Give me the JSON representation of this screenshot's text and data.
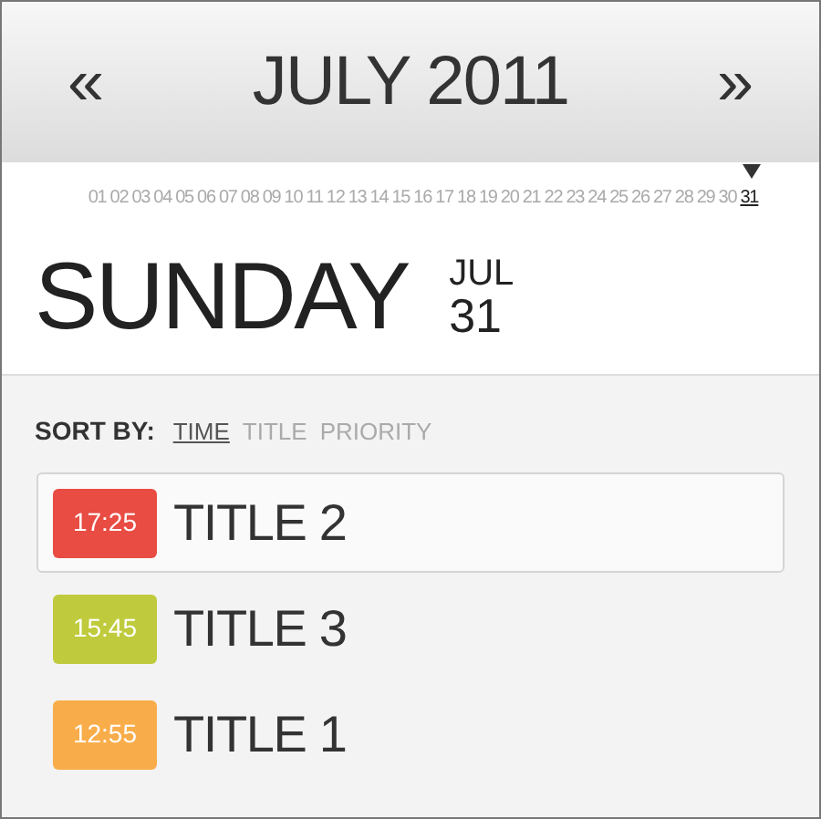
{
  "header": {
    "prev": "«",
    "title": "JULY 2011",
    "next": "»"
  },
  "days": [
    {
      "label": "01",
      "selected": false
    },
    {
      "label": "02",
      "selected": false
    },
    {
      "label": "03",
      "selected": false
    },
    {
      "label": "04",
      "selected": false
    },
    {
      "label": "05",
      "selected": false
    },
    {
      "label": "06",
      "selected": false
    },
    {
      "label": "07",
      "selected": false
    },
    {
      "label": "08",
      "selected": false
    },
    {
      "label": "09",
      "selected": false
    },
    {
      "label": "10",
      "selected": false
    },
    {
      "label": "11",
      "selected": false
    },
    {
      "label": "12",
      "selected": false
    },
    {
      "label": "13",
      "selected": false
    },
    {
      "label": "14",
      "selected": false
    },
    {
      "label": "15",
      "selected": false
    },
    {
      "label": "16",
      "selected": false
    },
    {
      "label": "17",
      "selected": false
    },
    {
      "label": "18",
      "selected": false
    },
    {
      "label": "19",
      "selected": false
    },
    {
      "label": "20",
      "selected": false
    },
    {
      "label": "21",
      "selected": false
    },
    {
      "label": "22",
      "selected": false
    },
    {
      "label": "23",
      "selected": false
    },
    {
      "label": "24",
      "selected": false
    },
    {
      "label": "25",
      "selected": false
    },
    {
      "label": "26",
      "selected": false
    },
    {
      "label": "27",
      "selected": false
    },
    {
      "label": "28",
      "selected": false
    },
    {
      "label": "29",
      "selected": false
    },
    {
      "label": "30",
      "selected": false
    },
    {
      "label": "31",
      "selected": true
    }
  ],
  "day": {
    "weekday": "SUNDAY",
    "month": "JUL",
    "date": "31"
  },
  "sort": {
    "label": "SORT BY:",
    "options": [
      {
        "label": "TIME",
        "selected": true
      },
      {
        "label": "TITLE",
        "selected": false
      },
      {
        "label": "PRIORITY",
        "selected": false
      }
    ]
  },
  "events": [
    {
      "time": "17:25",
      "title": "TITLE 2",
      "color": "#e84c43",
      "selected": true
    },
    {
      "time": "15:45",
      "title": "TITLE 3",
      "color": "#bfcb3c",
      "selected": false
    },
    {
      "time": "12:55",
      "title": "TITLE 1",
      "color": "#f9ad4a",
      "selected": false
    }
  ]
}
